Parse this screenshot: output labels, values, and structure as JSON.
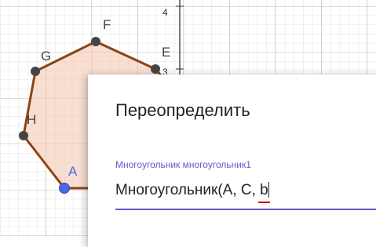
{
  "graph": {
    "y_axis_ticks": [
      "4",
      "3"
    ],
    "points": [
      {
        "label": "A",
        "selected": true
      },
      {
        "label": "H"
      },
      {
        "label": "G"
      },
      {
        "label": "F"
      },
      {
        "label": "E"
      }
    ],
    "colors": {
      "polygon_edge": "#8b4513",
      "polygon_fill": "#f3c5ad",
      "point": "#444444",
      "selected_point": "#4a69e0"
    }
  },
  "dialog": {
    "title": "Переопределить",
    "field_label": "Многоугольник многоугольник1",
    "field_value_prefix": "Многоугольник(A, C, ",
    "field_value_token": "b",
    "colors": {
      "accent": "#6557d2",
      "error_underline": "#cc1111"
    }
  }
}
